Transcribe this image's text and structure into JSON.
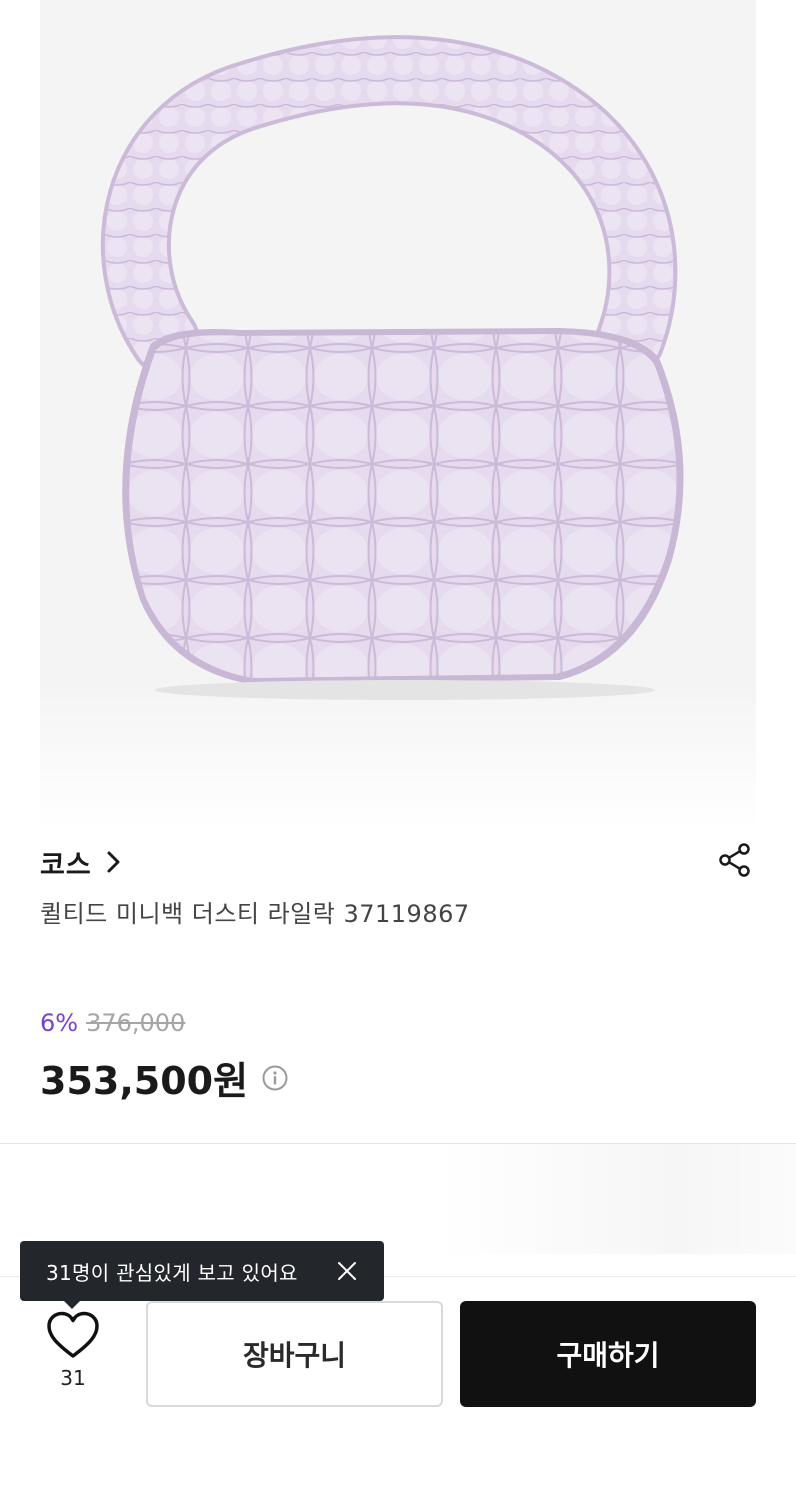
{
  "product": {
    "image_alt": "lilac quilted mini bag",
    "brand": "코스",
    "name": "퀼티드 미니백 더스티 라일락 37119867",
    "discount_rate": "6%",
    "original_price": "376,000",
    "sale_price": "353,500원",
    "bag_color": "#e3d6ec",
    "bag_shadow_color": "#c9b7d6"
  },
  "icons": {
    "brand_link": "chevron-right-icon",
    "share": "share-icon",
    "price_info": "info-icon",
    "like": "heart-icon",
    "tooltip_close": "close-icon"
  },
  "tooltip": {
    "text": "31명이 관심있게 보고 있어요"
  },
  "bottom_bar": {
    "like_count": "31",
    "cart_label": "장바구니",
    "buy_label": "구매하기"
  },
  "colors": {
    "accent_discount": "#7b3fd0",
    "buy_button": "#111111",
    "tooltip_bg": "#23272b"
  }
}
